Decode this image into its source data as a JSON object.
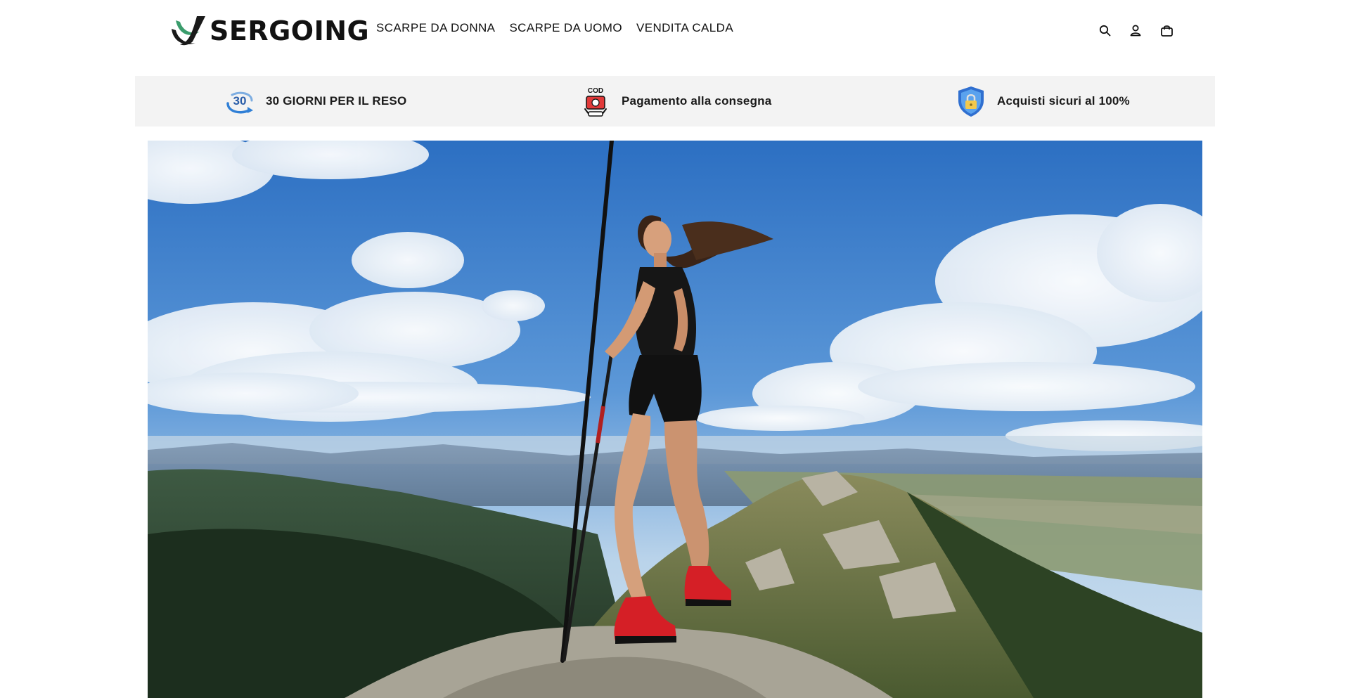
{
  "brand": {
    "name": "SERGOING"
  },
  "nav": {
    "items": [
      {
        "label": "SCARPE DA DONNA"
      },
      {
        "label": "SCARPE DA UOMO"
      },
      {
        "label": "VENDITA CALDA"
      }
    ]
  },
  "header_icons": [
    "search-icon",
    "account-icon",
    "cart-icon"
  ],
  "trust_bar": {
    "items": [
      {
        "icon": "30-day-return-icon",
        "badge": "30",
        "label": "30 GIORNI PER IL RESO"
      },
      {
        "icon": "cash-on-delivery-icon",
        "badge": "COD",
        "label": "Pagamento alla consegna"
      },
      {
        "icon": "secure-shield-icon",
        "label": "Acquisti sicuri al 100%"
      }
    ]
  },
  "hero": {
    "image": "hiker-on-mountain-summit"
  },
  "colors": {
    "brand_green": "#3a9c6c",
    "text": "#121212",
    "trust_bg": "#f3f3f3",
    "sky": "#3c7cc9"
  }
}
